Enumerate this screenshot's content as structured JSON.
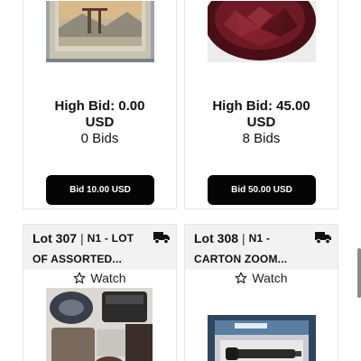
{
  "cards": [
    {
      "photo": "framed-painting-photo",
      "high_bid": "High Bid: 0.00",
      "currency": "USD",
      "bids": "0 Bids",
      "bid_button": "Bid 10.00 USD"
    },
    {
      "photo": "ruby-gemstone-photo",
      "high_bid": "High Bid: 45.00",
      "currency": "USD",
      "bids": "8 Bids",
      "bid_button": "Bid 50.00 USD"
    }
  ],
  "lots": [
    {
      "lot": "Lot 307",
      "separator": "|",
      "desc_line1": "N1 - LOT",
      "desc_line2": "OF ASSORTED...",
      "watch": "Watch",
      "icon": "delivery-truck-icon",
      "photo": "assorted-bags-photo"
    },
    {
      "lot": "Lot 308",
      "separator": "|",
      "desc_line1": "N1 -",
      "desc_line2": "CARTON ZOOM...",
      "watch": "Watch",
      "icon": "delivery-truck-icon",
      "photo": "flashlight-box-photo"
    }
  ],
  "colors": {
    "button_bg": "#050505",
    "header_bg": "#f2f2f2",
    "card_border": "#e6e6e6"
  }
}
